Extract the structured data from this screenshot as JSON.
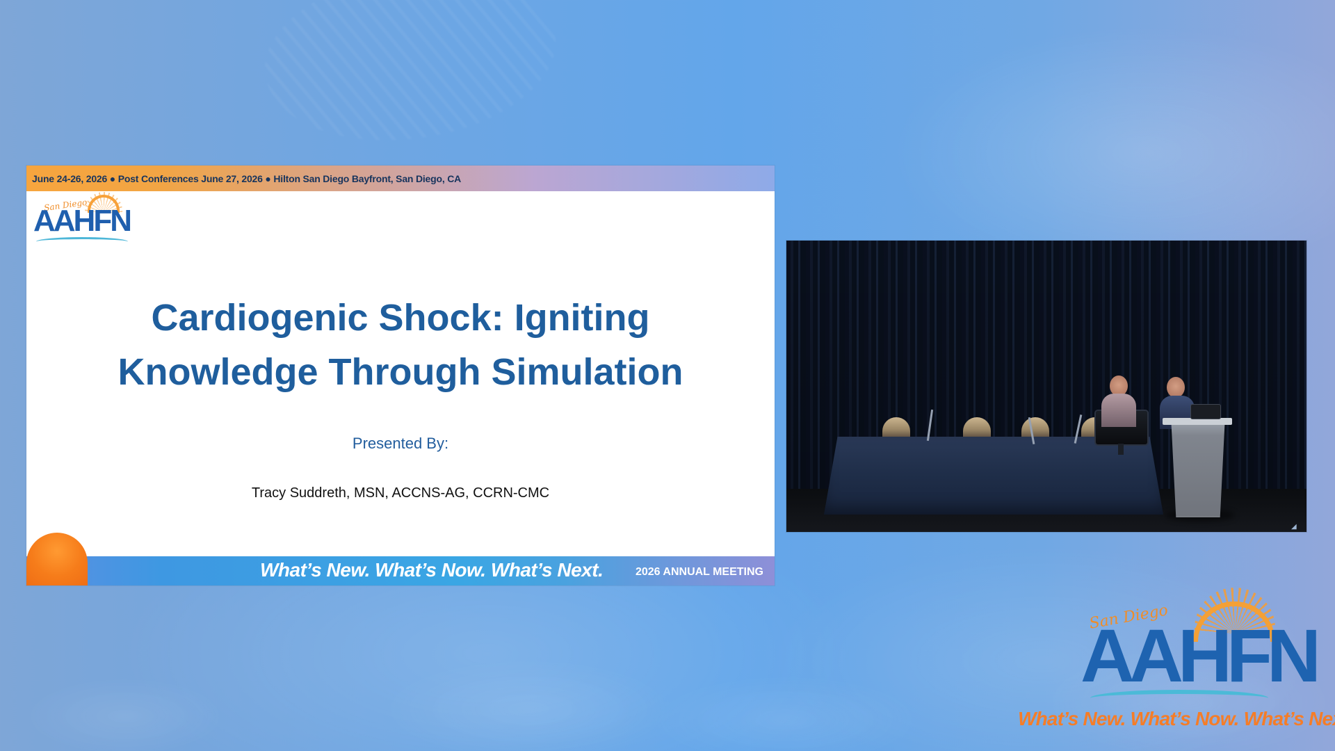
{
  "slide": {
    "top_banner": "June 24-26, 2026 ● Post Conferences June 27, 2026 ● Hilton San Diego Bayfront, San Diego, CA",
    "logo_script": "San Diego",
    "logo_word": "AAHFN",
    "title_line_1": "Cardiogenic Shock: Igniting",
    "title_line_2": "Knowledge Through Simulation",
    "presented_by": "Presented By:",
    "presenter": "Tracy Suddreth, MSN, ACCNS-AG, CCRN-CMC",
    "tagline": "What’s New. What’s Now. What’s Next.",
    "meeting": "2026 ANNUAL MEETING"
  },
  "corner_branding": {
    "logo_script": "San Diego",
    "logo_word": "AAHFN",
    "tagline": "What’s New. What’s Now. What’s Next."
  },
  "colors": {
    "page_background": "#67a7e8",
    "slide_title": "#1f5e9d",
    "slide_top_bar_start": "#f7a53e",
    "slide_top_bar_end": "#8eaae8",
    "slide_bottom_bar": "#3ea3e4",
    "accent_orange": "#f57d28",
    "logo_blue": "#1e63b0",
    "video_background": "#060910"
  },
  "icons": {
    "slide_logo": "aahfn-sun-logo",
    "corner_logo": "aahfn-sun-logo",
    "video_indicator": "corner-mark-icon"
  }
}
